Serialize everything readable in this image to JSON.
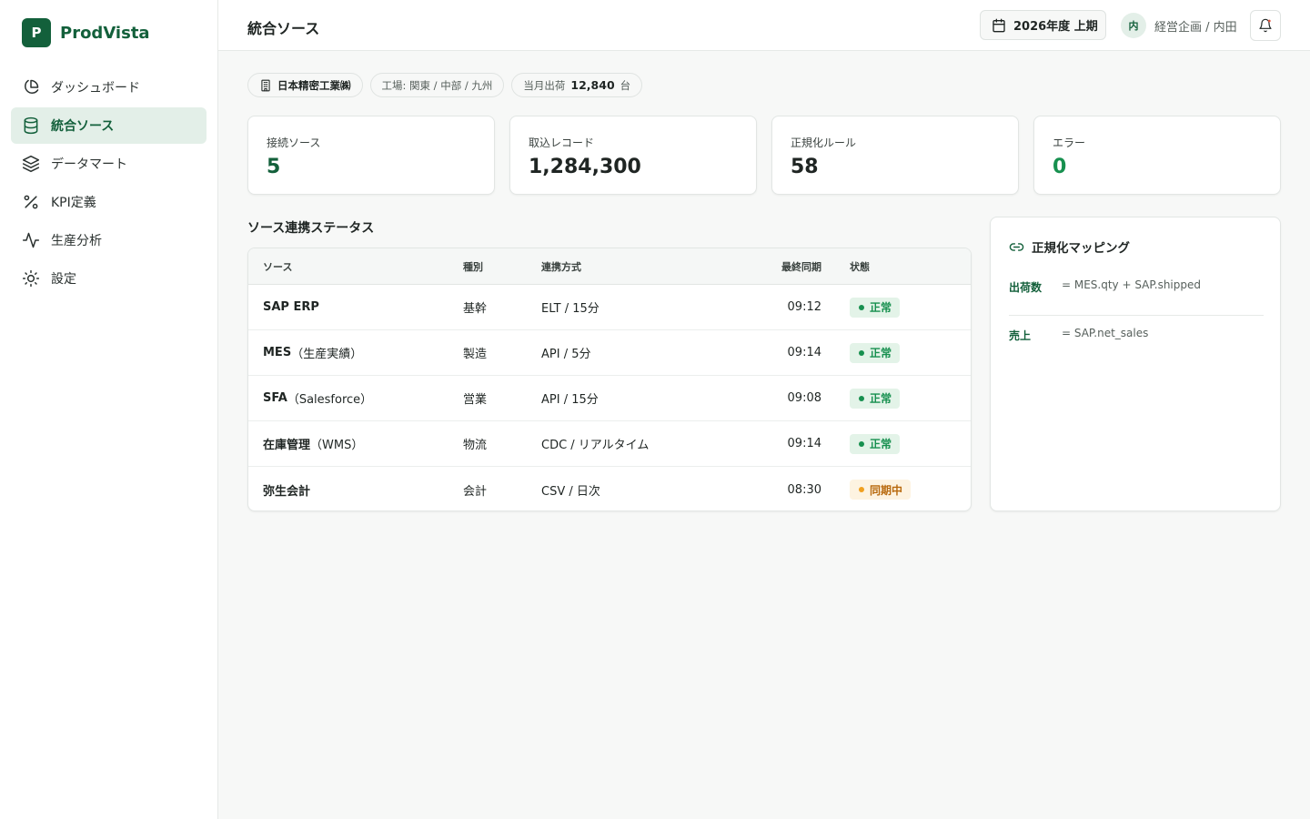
{
  "brand": {
    "logo_letter": "P",
    "name": "ProdVista"
  },
  "sidebar": {
    "items": [
      {
        "label": "ダッシュボード",
        "icon": "pie-chart-icon",
        "active": false
      },
      {
        "label": "統合ソース",
        "icon": "database-icon",
        "active": true
      },
      {
        "label": "データマート",
        "icon": "layers-icon",
        "active": false
      },
      {
        "label": "KPI定義",
        "icon": "percent-icon",
        "active": false
      },
      {
        "label": "生産分析",
        "icon": "activity-icon",
        "active": false
      },
      {
        "label": "設定",
        "icon": "sun-settings-icon",
        "active": false
      }
    ]
  },
  "header": {
    "title": "統合ソース",
    "period": "2026年度 上期",
    "user_initial": "内",
    "user_name": "経営企画 / 内田"
  },
  "context": {
    "company": "日本精密工業㈱",
    "plants": "工場: 関東 / 中部 / 九州",
    "shipment_label": "当月出荷",
    "shipment_value": "12,840",
    "shipment_unit": "台"
  },
  "stats": [
    {
      "label": "接続ソース",
      "value": "5"
    },
    {
      "label": "取込レコード",
      "value": "1,284,300"
    },
    {
      "label": "正規化ルール",
      "value": "58"
    },
    {
      "label": "エラー",
      "value": "0"
    }
  ],
  "sources": {
    "title": "ソース連携ステータス",
    "columns": {
      "source": "ソース",
      "type": "種別",
      "mode": "連携方式",
      "last_sync": "最終同期",
      "status": "状態"
    },
    "rows": [
      {
        "name": "SAP ERP",
        "suffix": "",
        "type": "基幹",
        "mode": "ELT / 15分",
        "last_sync": "09:12",
        "status": "正常",
        "status_kind": "ok"
      },
      {
        "name": "MES",
        "suffix": "（生産実績）",
        "type": "製造",
        "mode": "API / 5分",
        "last_sync": "09:14",
        "status": "正常",
        "status_kind": "ok"
      },
      {
        "name": "SFA",
        "suffix": "（Salesforce）",
        "type": "営業",
        "mode": "API / 15分",
        "last_sync": "09:08",
        "status": "正常",
        "status_kind": "ok"
      },
      {
        "name": "在庫管理",
        "suffix": "（WMS）",
        "type": "物流",
        "mode": "CDC / リアルタイム",
        "last_sync": "09:14",
        "status": "正常",
        "status_kind": "ok"
      },
      {
        "name": "弥生会計",
        "suffix": "",
        "type": "会計",
        "mode": "CSV / 日次",
        "last_sync": "08:30",
        "status": "同期中",
        "status_kind": "sync"
      }
    ]
  },
  "mapping": {
    "title": "正規化マッピング",
    "items": [
      {
        "key": "出荷数",
        "value": "= MES.qty + SAP.shipped"
      },
      {
        "key": "売上",
        "value": "= SAP.net_sales"
      }
    ]
  },
  "colors": {
    "brand": "#13603b",
    "ok_bg": "#e3f3e8",
    "ok_fg": "#17904f",
    "sync_bg": "#fdf3e1",
    "sync_fg": "#b8690d",
    "sync_dot": "#f0a020"
  }
}
